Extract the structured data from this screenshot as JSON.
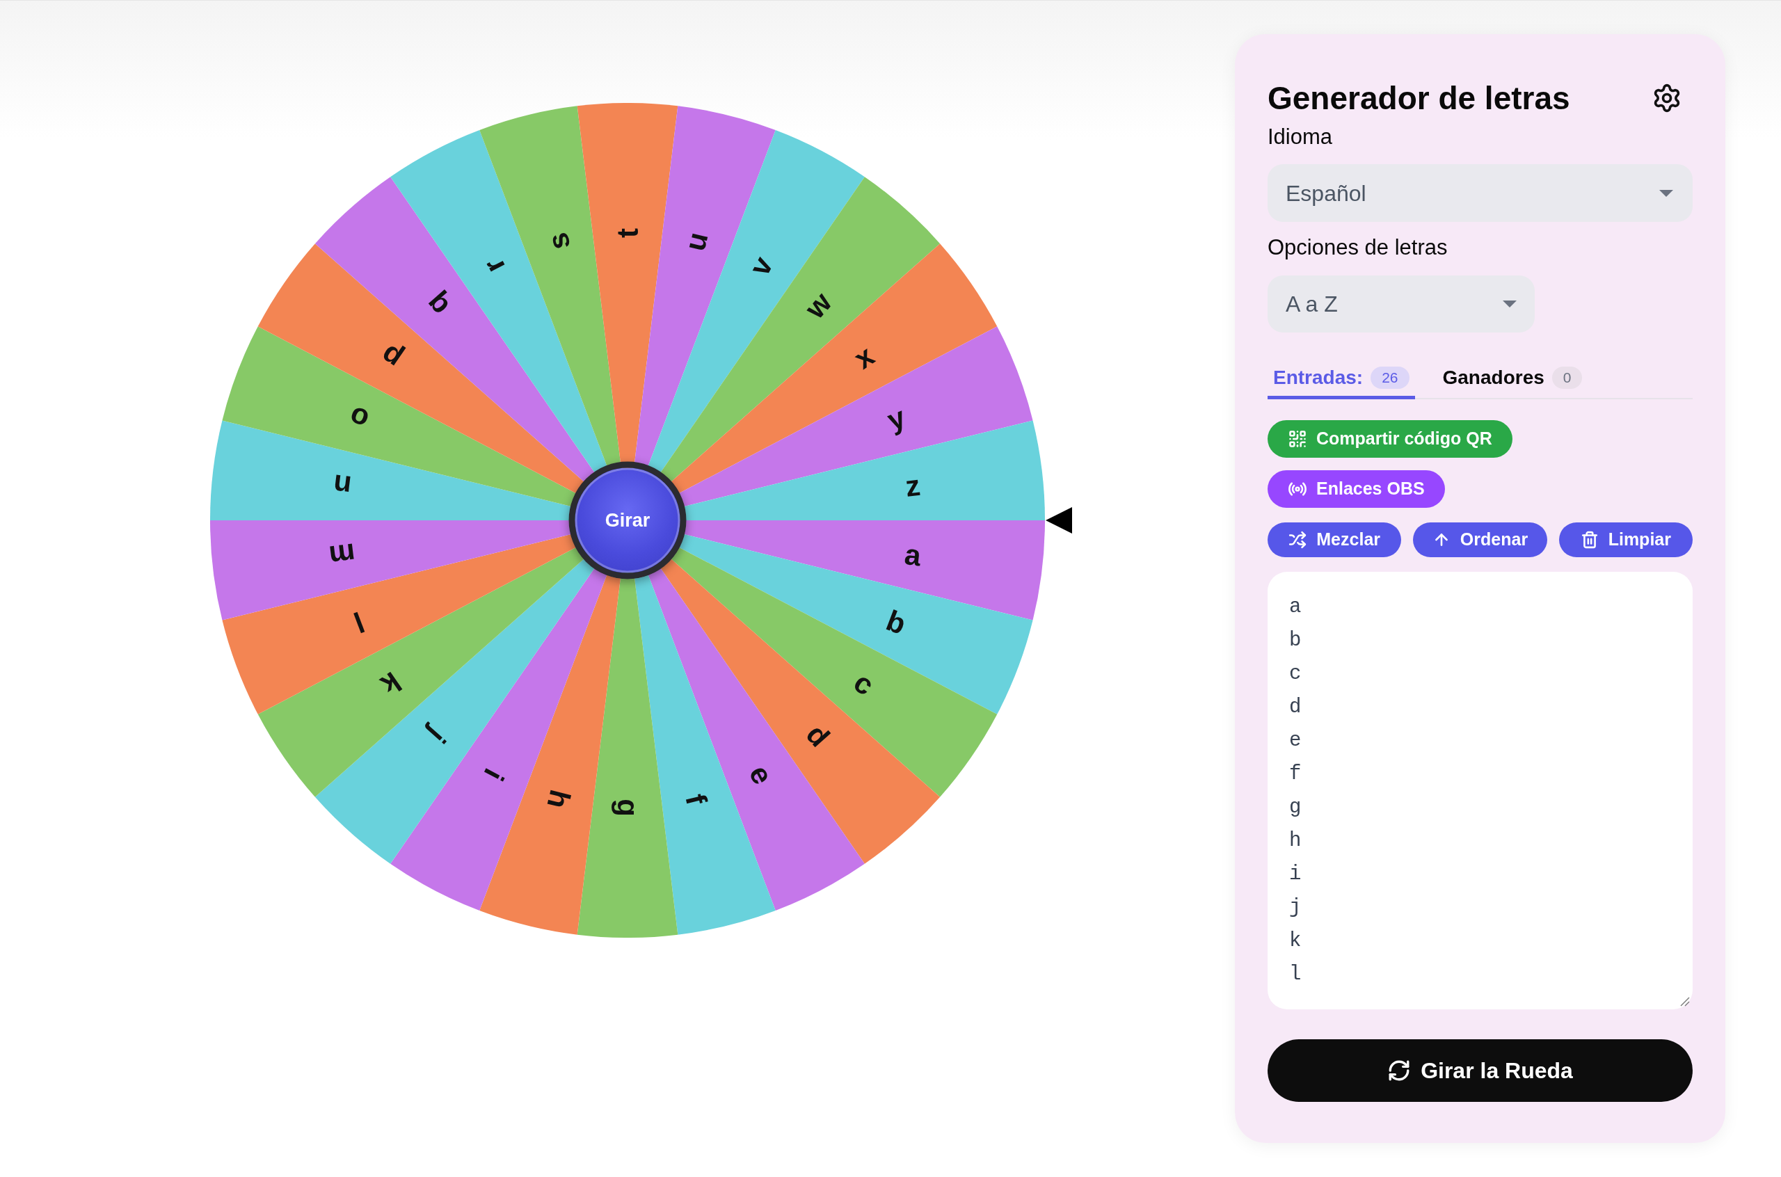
{
  "wheel": {
    "segments": [
      {
        "label": "a",
        "color": "#c577ea"
      },
      {
        "label": "b",
        "color": "#69d2dc"
      },
      {
        "label": "c",
        "color": "#87c967"
      },
      {
        "label": "d",
        "color": "#f38553"
      },
      {
        "label": "e",
        "color": "#c577ea"
      },
      {
        "label": "f",
        "color": "#69d2dc"
      },
      {
        "label": "g",
        "color": "#87c967"
      },
      {
        "label": "h",
        "color": "#f38553"
      },
      {
        "label": "i",
        "color": "#c577ea"
      },
      {
        "label": "j",
        "color": "#69d2dc"
      },
      {
        "label": "k",
        "color": "#87c967"
      },
      {
        "label": "l",
        "color": "#f38553"
      },
      {
        "label": "m",
        "color": "#c577ea"
      },
      {
        "label": "n",
        "color": "#69d2dc"
      },
      {
        "label": "o",
        "color": "#87c967"
      },
      {
        "label": "p",
        "color": "#f38553"
      },
      {
        "label": "q",
        "color": "#c577ea"
      },
      {
        "label": "r",
        "color": "#69d2dc"
      },
      {
        "label": "s",
        "color": "#87c967"
      },
      {
        "label": "t",
        "color": "#f38553"
      },
      {
        "label": "u",
        "color": "#c577ea"
      },
      {
        "label": "v",
        "color": "#69d2dc"
      },
      {
        "label": "w",
        "color": "#87c967"
      },
      {
        "label": "x",
        "color": "#f38553"
      },
      {
        "label": "y",
        "color": "#c577ea"
      },
      {
        "label": "z",
        "color": "#69d2dc"
      }
    ],
    "center_button": "Girar"
  },
  "panel": {
    "title": "Generador de letras",
    "language": {
      "label": "Idioma",
      "value": "Español"
    },
    "letter_options": {
      "label": "Opciones de letras",
      "value": "A a Z"
    },
    "tabs": [
      {
        "label": "Entradas:",
        "count": "26",
        "selected": true
      },
      {
        "label": "Ganadores",
        "count": "0",
        "selected": false
      }
    ],
    "share_buttons": [
      {
        "kind": "qr",
        "label": "Compartir código QR"
      },
      {
        "kind": "obs",
        "label": "Enlaces OBS"
      }
    ],
    "list_buttons": [
      {
        "kind": "shuffle",
        "label": "Mezclar"
      },
      {
        "kind": "sort",
        "label": "Ordenar"
      },
      {
        "kind": "clear",
        "label": "Limpiar"
      }
    ],
    "entries": [
      "a",
      "b",
      "c",
      "d",
      "e",
      "f",
      "g",
      "h",
      "i",
      "j",
      "k",
      "l"
    ],
    "spin_button": "Girar la Rueda"
  }
}
